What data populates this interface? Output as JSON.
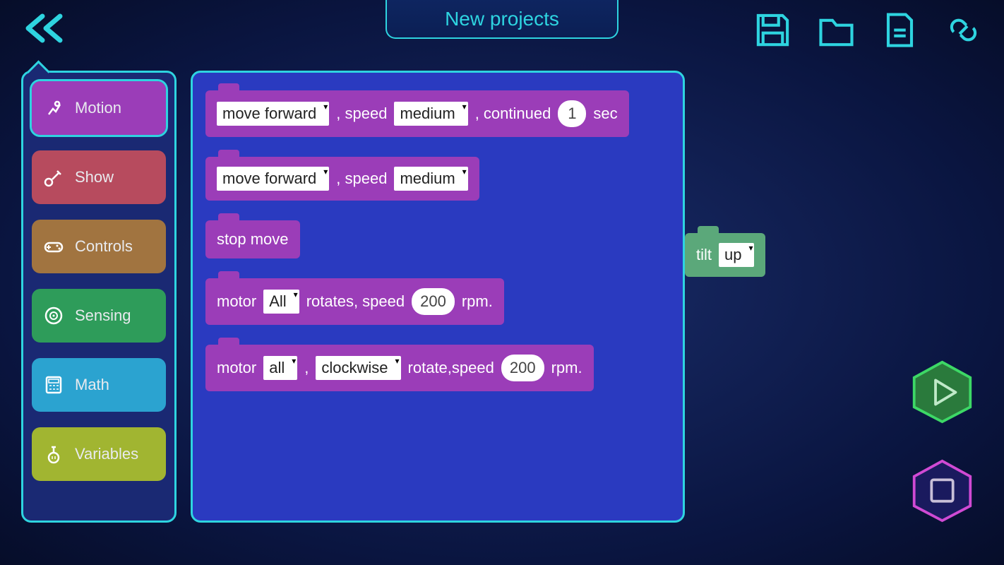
{
  "title": "New projects",
  "categories": [
    {
      "name": "Motion"
    },
    {
      "name": "Show"
    },
    {
      "name": "Controls"
    },
    {
      "name": "Sensing"
    },
    {
      "name": "Math"
    },
    {
      "name": "Variables"
    }
  ],
  "blocks": {
    "b1": {
      "dir": "move forward",
      "speedLabel": ", speed",
      "speed": "medium",
      "contLabel": ", continued",
      "dur": "1",
      "unit": "sec"
    },
    "b2": {
      "dir": "move forward",
      "speedLabel": ", speed",
      "speed": "medium"
    },
    "b3": {
      "label": "stop move"
    },
    "b4": {
      "pre": "motor",
      "sel": "All",
      "mid": "rotates, speed",
      "val": "200",
      "suf": "rpm."
    },
    "b5": {
      "pre": "motor",
      "sel": "all",
      "comma": ",",
      "rot": "clockwise",
      "mid": "rotate,speed",
      "val": "200",
      "suf": "rpm."
    }
  },
  "floating": {
    "pre": "tilt",
    "val": "up"
  }
}
